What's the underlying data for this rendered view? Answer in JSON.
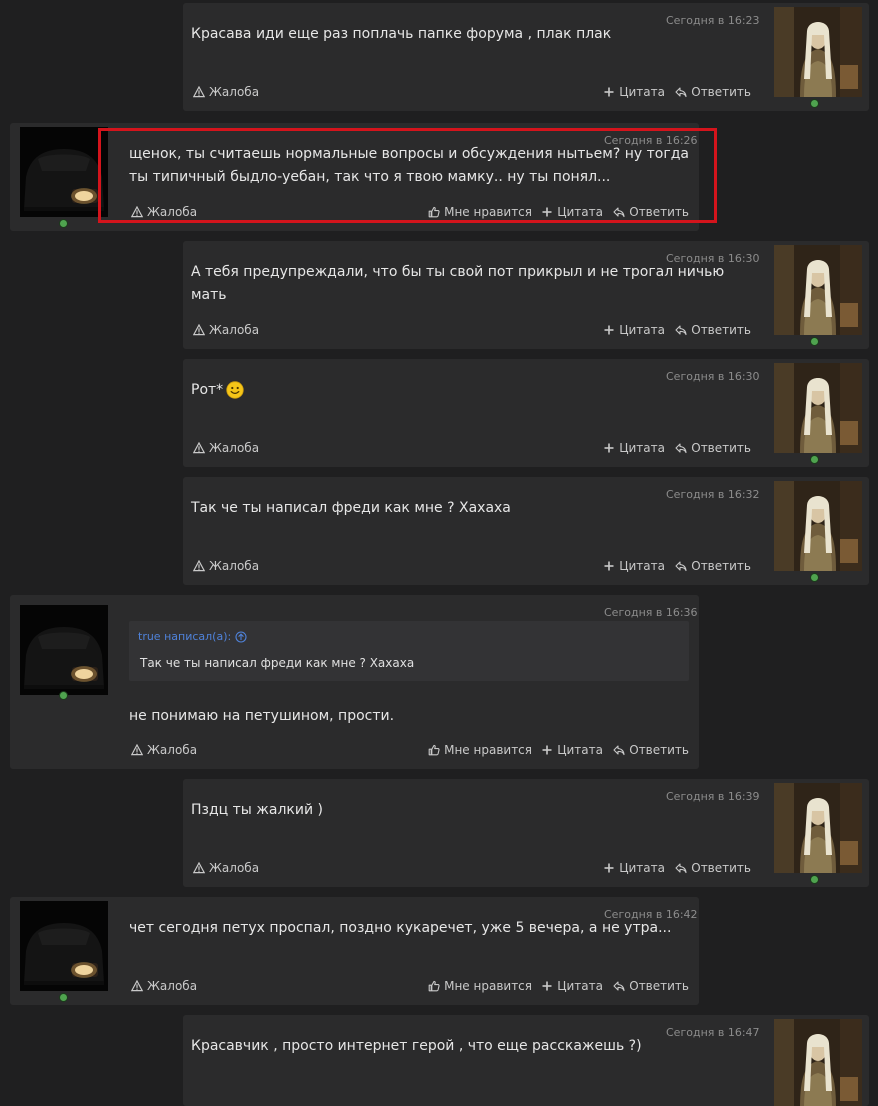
{
  "actions": {
    "report": "Жалоба",
    "like": "Мне нравится",
    "quote": "Цитата",
    "reply": "Ответить"
  },
  "posts": [
    {
      "time": "Сегодня в 16:23",
      "text": "Красава иди еще раз поплачь папке форума , плак плак"
    },
    {
      "time": "Сегодня в 16:26",
      "text": "щенок, ты считаешь нормальные вопросы и обсуждения нытьем? ну тогда ты типичный быдло-уебан, так что я твою мамку.. ну ты понял..."
    },
    {
      "time": "Сегодня в 16:30",
      "text": "А тебя предупреждали, что бы ты свой пот прикрыл и не трогал ничью мать"
    },
    {
      "time": "Сегодня в 16:30",
      "text": "Рот*",
      "emoji": "smiley-face"
    },
    {
      "time": "Сегодня в 16:32",
      "text": "Так че ты написал фреди как мне ? Хахаха"
    },
    {
      "time": "Сегодня в 16:36",
      "text": "не понимаю на петушином, прости.",
      "quote": {
        "author": "true написал(а):",
        "text": "Так че ты написал фреди как мне ? Хахаха"
      }
    },
    {
      "time": "Сегодня в 16:39",
      "text": "Пздц ты жалкий )"
    },
    {
      "time": "Сегодня в 16:42",
      "text": "чет сегодня петух проспал, поздно кукаречет, уже 5 вечера, а не утра..."
    },
    {
      "time": "Сегодня в 16:47",
      "text": "Красавчик , просто интернет герой , что еще расскажешь ?)"
    }
  ],
  "colors": {
    "highlight": "#d4141c",
    "online": "#4fa34f",
    "quote_author": "#4f82d9"
  }
}
